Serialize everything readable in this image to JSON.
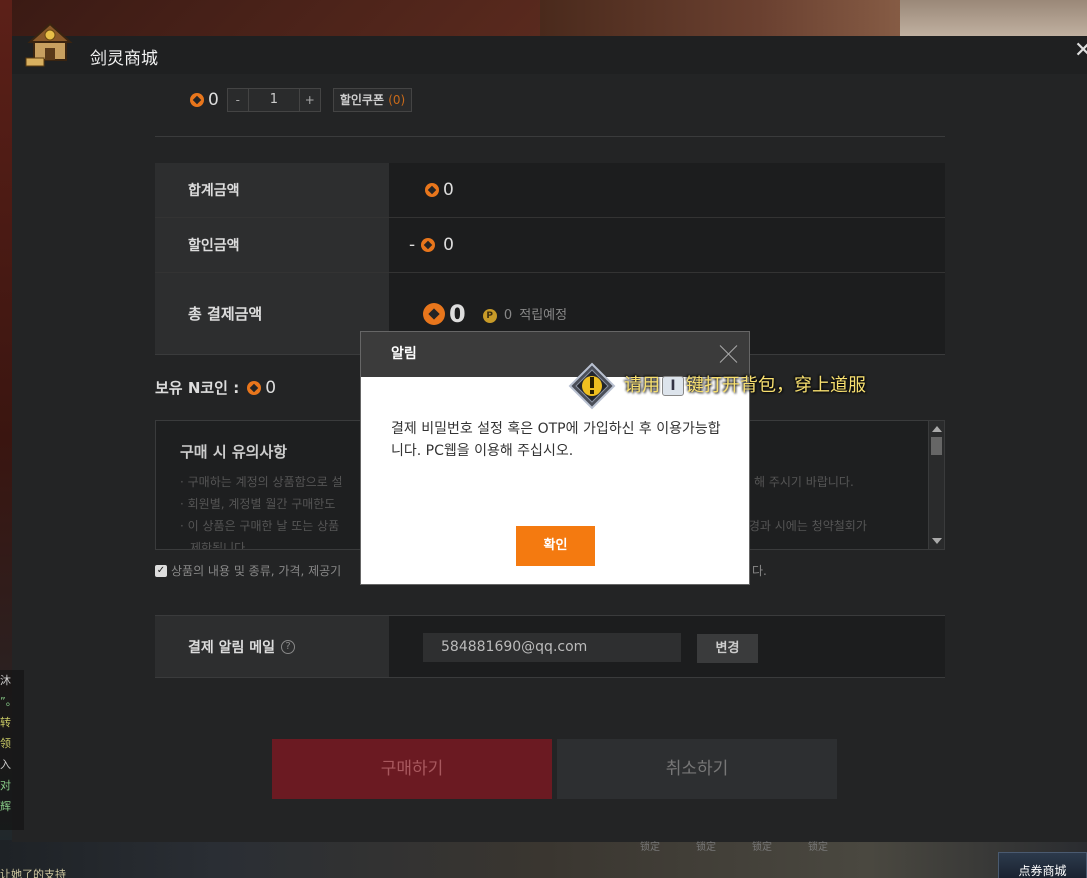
{
  "window": {
    "title": "剑灵商城",
    "close_label": "✕"
  },
  "purchase": {
    "price": "0",
    "minus_label": "-",
    "quantity": "1",
    "plus_label": "+",
    "coupon_label": "할인쿠폰",
    "coupon_count": "(0)"
  },
  "summary": {
    "total_label": "합계금액",
    "total_value": "0",
    "discount_label": "할인금액",
    "discount_prefix": "-",
    "discount_value": "0",
    "pay_label": "총 결제금액",
    "pay_value": "0",
    "earn_value": "0",
    "earn_label": "적립예정"
  },
  "holding": {
    "label": "보유 N코인 :",
    "value": "0"
  },
  "notice": {
    "title": "구매 시 유의사항",
    "line1": "· 구매하는 계정의 상품함으로 설",
    "line2": "· 회원별, 계정별 월간 구매한도",
    "line3": "· 이 상품은 구매한 날 또는 상품",
    "line4": "제한됩니다.",
    "line1_right": "해 주시기 바랍니다.",
    "line3_right": "일 경과 시에는 청약철회가"
  },
  "agree": {
    "checkmark": "✓",
    "text": "상품의 내용 및 종류, 가격, 제공기",
    "text_right": "다."
  },
  "mail": {
    "label": "결제 알림 메일",
    "help": "?",
    "value": "584881690@qq.com",
    "change_label": "변경"
  },
  "actions": {
    "buy_label": "구매하기",
    "cancel_label": "취소하기"
  },
  "modal": {
    "title": "알림",
    "message": "결제 비밀번호 설정 혹은 OTP에 가입하신 후 이용가능합니다. PC웹을 이용해 주십시오.",
    "ok_label": "확인"
  },
  "game_tip": {
    "text_before": "请用",
    "key": "I",
    "text_after": "键打开背包，穿上道服"
  },
  "game_ui": {
    "bottom_text": "让她了的支持",
    "lock_label": "锁定",
    "shop_tab": "点券商城",
    "chat_lines": [
      "沐",
      "”。",
      "转",
      "领",
      "入",
      "对",
      "辉"
    ]
  },
  "colors": {
    "coin_orange": "#e8761c",
    "confirm_orange": "#f47a10",
    "buy_red": "#6b1a22",
    "tip_yellow": "#f8e070"
  }
}
